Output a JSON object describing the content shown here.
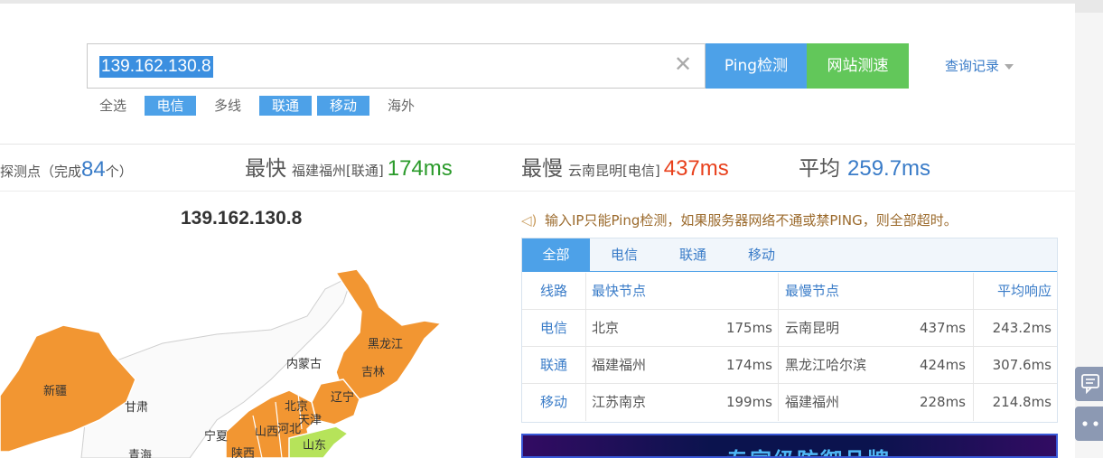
{
  "search": {
    "value": "139.162.130.8",
    "clear_icon": "close-icon"
  },
  "buttons": {
    "ping": "Ping检测",
    "speed": "网站测速",
    "history": "查询记录"
  },
  "filters": [
    {
      "label": "全选",
      "active": false
    },
    {
      "label": "电信",
      "active": true
    },
    {
      "label": "多线",
      "active": false
    },
    {
      "label": "联通",
      "active": true
    },
    {
      "label": "移动",
      "active": true
    },
    {
      "label": "海外",
      "active": false
    }
  ],
  "summary": {
    "probe_prefix": "探测点（完成",
    "probe_count": "84",
    "probe_suffix": "个）",
    "fastest_label": "最快",
    "fastest_loc": "福建福州[联通]",
    "fastest_val": "174ms",
    "slowest_label": "最慢",
    "slowest_loc": "云南昆明[电信]",
    "slowest_val": "437ms",
    "avg_label": "平均",
    "avg_val": "259.7ms"
  },
  "map": {
    "title": "139.162.130.8",
    "labels": [
      "新疆",
      "甘肃",
      "青海",
      "宁夏",
      "陕西",
      "山西",
      "河北",
      "北京",
      "天津",
      "山东",
      "内蒙古",
      "辽宁",
      "吉林",
      "黑龙江"
    ]
  },
  "notice": "输入IP只能Ping检测，如果服务器网络不通或禁PING，则全部超时。",
  "tabs": [
    "全部",
    "电信",
    "联通",
    "移动"
  ],
  "table": {
    "headers": [
      "线路",
      "最快节点",
      "最慢节点",
      "平均响应"
    ],
    "rows": [
      {
        "line": "电信",
        "fast_node": "北京",
        "fast_ms": "175ms",
        "slow_node": "云南昆明",
        "slow_ms": "437ms",
        "avg": "243.2ms"
      },
      {
        "line": "联通",
        "fast_node": "福建福州",
        "fast_ms": "174ms",
        "slow_node": "黑龙江哈尔滨",
        "slow_ms": "424ms",
        "avg": "307.6ms"
      },
      {
        "line": "移动",
        "fast_node": "江苏南京",
        "fast_ms": "199ms",
        "slow_node": "福建福州",
        "slow_ms": "228ms",
        "avg": "214.8ms"
      }
    ]
  },
  "banner": {
    "text": "专家级防御品牌"
  },
  "colors": {
    "accent": "#4da1e8",
    "speed_button": "#62c75a",
    "fastest": "#2a9a2a",
    "slowest": "#e8401c",
    "average": "#3a7cc8",
    "map_orange": "#f29632",
    "map_green": "#b6e35a"
  }
}
